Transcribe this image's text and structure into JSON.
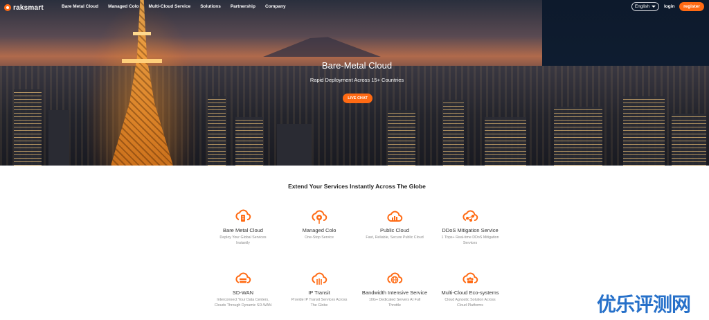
{
  "nav": {
    "logo_text": "raksmart",
    "links": [
      "Bare Metal Cloud",
      "Managed Colo",
      "Multi-Cloud Service",
      "Solutions",
      "Partnership",
      "Company"
    ],
    "language": "English",
    "login": "login",
    "register": "register"
  },
  "hero": {
    "title": "Bare-Metal Cloud",
    "subtitle": "Rapid Deployment Across 15+ Countries",
    "cta": "LIVE CHAT"
  },
  "services": {
    "heading": "Extend Your Services Instantly Across The Globe",
    "accent_color": "#ff6a13",
    "items": [
      {
        "name": "Bare Metal Cloud",
        "desc": "Deploy Your Global Services Instantly",
        "icon": "cloud-server-icon"
      },
      {
        "name": "Managed Colo",
        "desc": "One-Stop Service",
        "icon": "cloud-gear-icon"
      },
      {
        "name": "Public Cloud",
        "desc": "Fast, Reliable, Secure Public Cloud",
        "icon": "cloud-chart-icon"
      },
      {
        "name": "DDoS Mitigation Service",
        "desc": "1 Tbps+ Real-time DDoS Mitigation Services",
        "icon": "shield-network-icon"
      },
      {
        "name": "SD-WAN",
        "desc": "Interconnect Your Data Centers, Clouds Through Dynamic SD-WAN",
        "icon": "cloud-stack-icon"
      },
      {
        "name": "IP Transit",
        "desc": "Provide IP Transit Services Across The Globe",
        "icon": "cloud-bars-icon"
      },
      {
        "name": "Bandwidth Intensive Service",
        "desc": "10G+ Dedicated Servers At Full Throttle",
        "icon": "globe-cloud-icon"
      },
      {
        "name": "Multi-Cloud Eco-systems",
        "desc": "Cloud Agnostic Solution Across Cloud Platforms",
        "icon": "cloud-users-icon"
      }
    ]
  },
  "watermark": "优乐评测网"
}
